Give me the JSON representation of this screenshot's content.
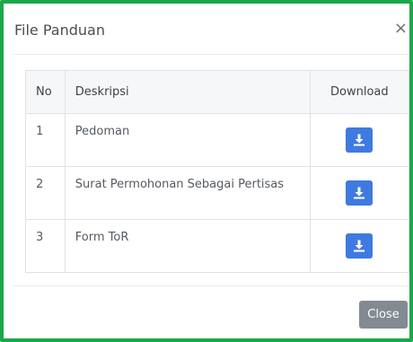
{
  "modal": {
    "title": "File Panduan",
    "close_symbol": "×",
    "close_button_label": "Close"
  },
  "table": {
    "headers": {
      "no": "No",
      "deskripsi": "Deskripsi",
      "download": "Download"
    },
    "rows": [
      {
        "no": "1",
        "deskripsi": "Pedoman",
        "download_icon": "download-icon"
      },
      {
        "no": "2",
        "deskripsi": "Surat Permohonan Sebagai Pertisas",
        "download_icon": "download-icon"
      },
      {
        "no": "3",
        "deskripsi": "Form ToR",
        "download_icon": "download-icon"
      }
    ]
  },
  "colors": {
    "frame_border": "#1aa84a",
    "download_button": "#3f7ae0",
    "close_button": "#838a91"
  }
}
